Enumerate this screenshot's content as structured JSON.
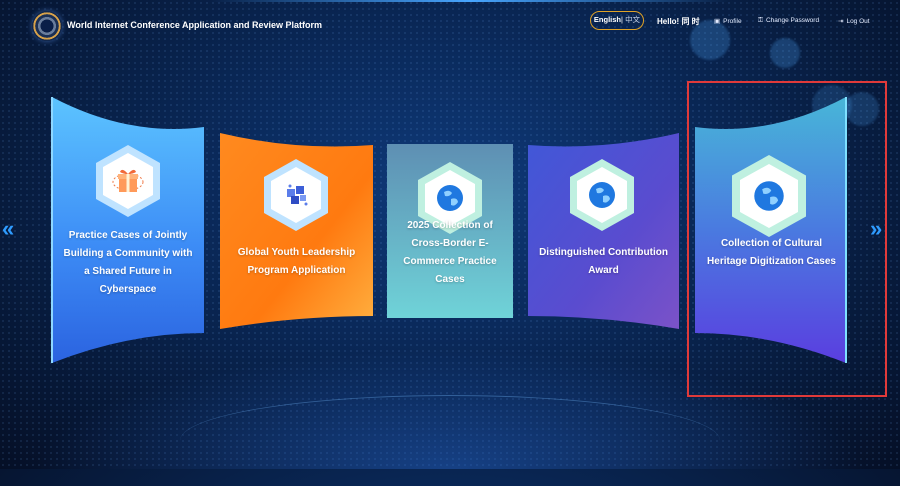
{
  "header": {
    "app_title": "World Internet Conference Application and Review Platform",
    "lang_english": "English",
    "lang_separator": "|",
    "lang_chinese": "中文",
    "greeting": "Hello! 同 时",
    "profile": "Profile",
    "change_password": "Change Password",
    "log_out": "Log Out"
  },
  "cards": [
    {
      "label": "Practice Cases of Jointly Building a Community with a Shared Future in Cyberspace",
      "icon": "gift-icon"
    },
    {
      "label": "Global Youth Leadership Program Application",
      "icon": "cube-icon"
    },
    {
      "label": "2025 Collection of Cross-Border E-Commerce Practice Cases",
      "icon": "globe-icon"
    },
    {
      "label": "Distinguished Contribution Award",
      "icon": "globe-icon"
    },
    {
      "label": "Collection of Cultural Heritage Digitization Cases",
      "icon": "globe-icon"
    }
  ],
  "colors": {
    "accent_gold": "#e0a226",
    "highlight_red": "#e03a3a",
    "arrow_blue": "#2f9cff"
  },
  "nav": {
    "left": "«",
    "right": "»"
  }
}
